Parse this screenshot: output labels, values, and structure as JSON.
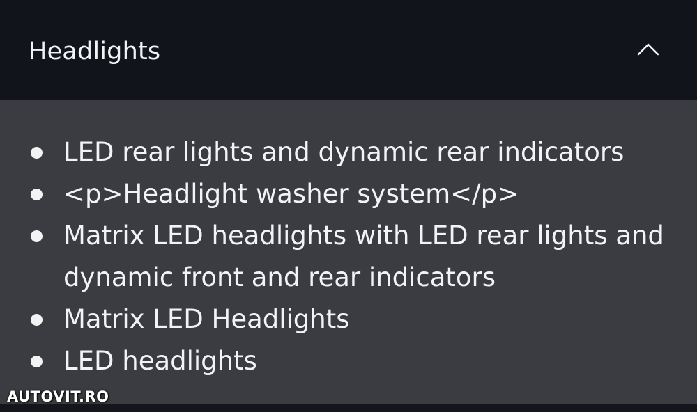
{
  "accordion": {
    "title": "Headlights",
    "expanded": true,
    "toggle_icon": "chevron-up-icon",
    "items": [
      "LED rear lights and dynamic rear indicators",
      "<p>Headlight washer system</p>",
      "Matrix LED headlights with LED rear lights and dynamic front and rear indicators",
      "Matrix LED Headlights",
      "LED headlights"
    ]
  },
  "watermark": {
    "text": "AUTOVIT.RO"
  },
  "colors": {
    "header_bg": "#11141b",
    "body_bg": "#3b3c41",
    "text": "#f2f3f5"
  }
}
